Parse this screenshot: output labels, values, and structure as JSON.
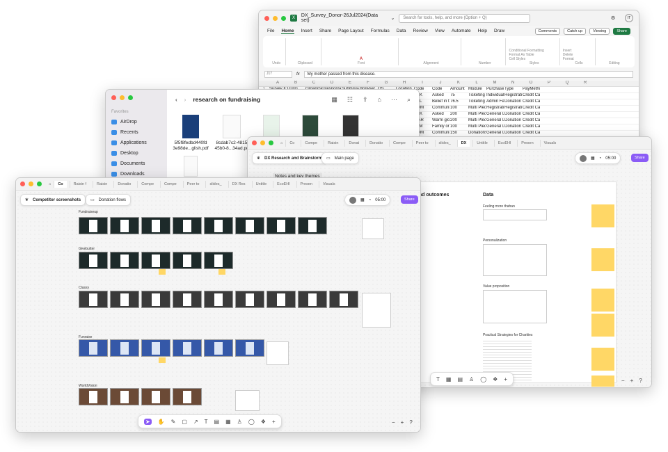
{
  "excel": {
    "filename": "DX_Survey_Donor-26Jul2024(Data set)",
    "search_placeholder": "Search for tools, help, and more (Option + Q)",
    "avatar": "IT",
    "menu": [
      "File",
      "Home",
      "Insert",
      "Share",
      "Page Layout",
      "Formulas",
      "Data",
      "Review",
      "View",
      "Automate",
      "Help",
      "Draw"
    ],
    "buttons": {
      "comments": "Comments",
      "catchup": "Catch up",
      "viewing": "Viewing",
      "share": "Share"
    },
    "ribbon_groups": [
      "Undo",
      "Clipboard",
      "Font",
      "Alignment",
      "Number",
      "Styles",
      "Cells",
      "Editing"
    ],
    "ribbon_items": [
      "Conditional Formatting",
      "Format As Table",
      "Cell Styles",
      "Insert",
      "Delete",
      "Format"
    ],
    "cell_ref": "J17",
    "formula_value": "My mother passed from this disease.",
    "columns": [
      "A",
      "B",
      "C",
      "D",
      "E",
      "F",
      "G",
      "H",
      "I",
      "J",
      "K",
      "L",
      "M",
      "N",
      "O",
      "P",
      "Q",
      "R"
    ],
    "rows": [
      [
        "1",
        "Survey ID",
        "UUID",
        "Organizati",
        "Response",
        "Submissio",
        "Browser",
        "OS",
        "Location",
        "Code",
        "Code",
        "Amount",
        "Module",
        "Purchase I",
        "Type",
        "PayMethod"
      ],
      [
        "",
        "",
        "",
        "",
        "",
        "",
        "",
        "",
        "",
        "ASK",
        "Asked",
        "75",
        "Ticketing",
        "Individual",
        "Registratic",
        "Credit Card"
      ],
      [
        "",
        "",
        "",
        "",
        "",
        "",
        "",
        "",
        "",
        "BEL",
        "Belief in th",
        "76.5",
        "Ticketing",
        "Admin Fee",
        "Donation",
        "Credit Card"
      ],
      [
        "",
        "",
        "",
        "",
        "",
        "",
        "",
        "",
        "",
        "COM",
        "Communit",
        "100",
        "Multi Pled",
        "Registratic",
        "Registratic",
        "Credit Card"
      ],
      [
        "",
        "",
        "",
        "",
        "",
        "",
        "",
        "",
        "art",
        "ASK",
        "Asked",
        "200",
        "Multi Pled",
        "General D",
        "Donation",
        "Credit Card"
      ],
      [
        "",
        "",
        "",
        "",
        "",
        "",
        "",
        "",
        "ala",
        "WAR",
        "Warm glov",
        "200",
        "Multi Pled",
        "General D",
        "Donation",
        "Credit Card"
      ],
      [
        "",
        "",
        "",
        "",
        "",
        "",
        "",
        "",
        "",
        "FAM",
        "Family or l",
        "100",
        "Multi Pled",
        "General D",
        "Donation",
        "Credit Card"
      ],
      [
        "",
        "",
        "",
        "",
        "",
        "",
        "",
        "",
        "",
        "COM",
        "Communit",
        "150",
        "Donations",
        "General D",
        "Donation",
        "Credit Card"
      ],
      [
        "",
        "",
        "",
        "",
        "",
        "",
        "",
        "",
        "",
        "BEL",
        "Belief in th",
        "100",
        "Multi Pled",
        "General D",
        "Donation",
        "Credit Card"
      ]
    ]
  },
  "finder": {
    "title": "research on fundraising",
    "sidebar_header": "Favorites",
    "sidebar": [
      "AirDrop",
      "Recents",
      "Applications",
      "Desktop",
      "Documents",
      "Downloads"
    ],
    "files": [
      {
        "name1": "5f5f8fedbd440fd",
        "name2": "3e98de...glish.pdf"
      },
      {
        "name1": "8cdab7c2-4815-",
        "name2": "45b0-8...34ad.pdf"
      }
    ]
  },
  "fig2": {
    "tabs": [
      "Co",
      "Compe",
      "Raisin",
      "Donat",
      "Donatio",
      "Compe",
      "Peer to",
      "slides_",
      "DX",
      "Untitle",
      "EcoEHl",
      "Presen",
      "Visuals"
    ],
    "active_tab": "DX",
    "page1": "DX Research and Brainstorm",
    "page2": "Main page",
    "timer": "05:00",
    "share": "Share",
    "section_notes": "Notes and key themes",
    "section_outcomes": "...nd outcomes",
    "section_data": "Data",
    "groups": [
      "Feeling more thahan",
      "Personalization",
      "Value proposition",
      "Practical Strategies for Charities"
    ]
  },
  "fig1": {
    "tabs": [
      "Co",
      "Raisin f",
      "Raisin",
      "Donatio",
      "Compe",
      "Compe",
      "Peer to",
      "slides_",
      "DX Res",
      "Untitle",
      "EcoEHl",
      "Presen",
      "Visuals"
    ],
    "active_tab": "Co",
    "page1": "Competitor screenshots",
    "page2": "Donation flows",
    "timer": "05:00",
    "share": "Share",
    "sections": [
      "Fundraiseup",
      "Givebutter",
      "Classy",
      "Funraise",
      "WorldVision"
    ]
  }
}
